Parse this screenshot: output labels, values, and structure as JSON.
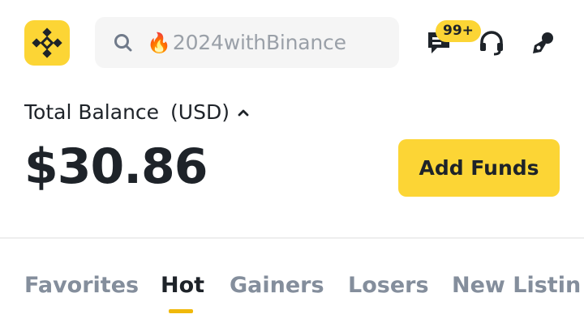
{
  "header": {
    "search": {
      "placeholder": "2024withBinance",
      "prefix_icon": "fire-emoji",
      "icon": "search-icon"
    },
    "icons": [
      "binance-logo-icon",
      "messages-icon",
      "headset-icon",
      "profile-edit-icon"
    ],
    "notification_badge": "99+"
  },
  "balance": {
    "label": "Total Balance",
    "currency": "(USD)",
    "value": "$30.86",
    "add_funds_label": "Add Funds"
  },
  "market_tabs": {
    "items": [
      {
        "label": "Favorites",
        "active": false
      },
      {
        "label": "Hot",
        "active": true
      },
      {
        "label": "Gainers",
        "active": false
      },
      {
        "label": "Losers",
        "active": false
      },
      {
        "label": "New Listin",
        "active": false
      }
    ]
  },
  "colors": {
    "brand_yellow": "#FCD535",
    "accent_underline": "#F0B90B",
    "text_primary": "#1E2329",
    "text_secondary": "#848E9C"
  }
}
